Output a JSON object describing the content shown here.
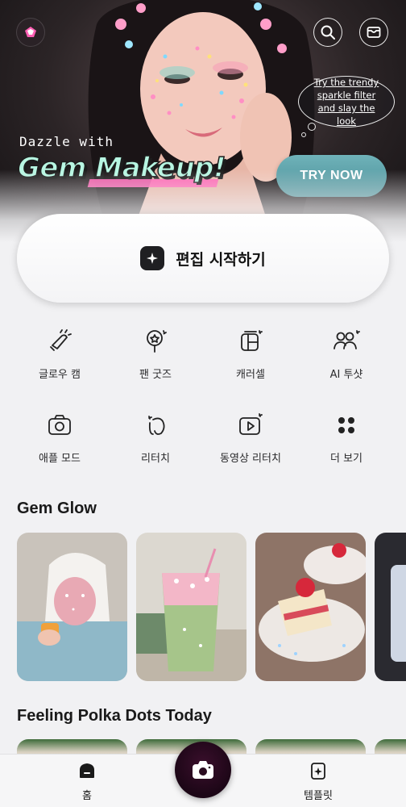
{
  "hero": {
    "bubble_text": "Try the trendy sparkle filter and slay the look",
    "dazzle_text": "Dazzle with",
    "title_text": "Gem Makeup!",
    "cta_label": "TRY NOW"
  },
  "start_edit": {
    "label": "편집 시작하기"
  },
  "menu": [
    {
      "label": "글로우 캠",
      "icon": "glow-cam-icon"
    },
    {
      "label": "팬 굿즈",
      "icon": "fan-goods-icon"
    },
    {
      "label": "캐러셀",
      "icon": "carousel-icon"
    },
    {
      "label": "AI 투샷",
      "icon": "ai-two-shot-icon"
    },
    {
      "label": "애플 모드",
      "icon": "camera-icon"
    },
    {
      "label": "리터치",
      "icon": "retouch-icon"
    },
    {
      "label": "동영상 리터치",
      "icon": "video-retouch-icon"
    },
    {
      "label": "더 보기",
      "icon": "more-icon"
    }
  ],
  "sections": {
    "gem_glow": {
      "title": "Gem Glow"
    },
    "polka": {
      "title": "Feeling Polka Dots Today"
    }
  },
  "colors": {
    "accent_teal": "#5a9ea6",
    "camera_button": "#2a0b20"
  },
  "bottom_nav": {
    "home_label": "홈",
    "template_label": "템플릿"
  }
}
